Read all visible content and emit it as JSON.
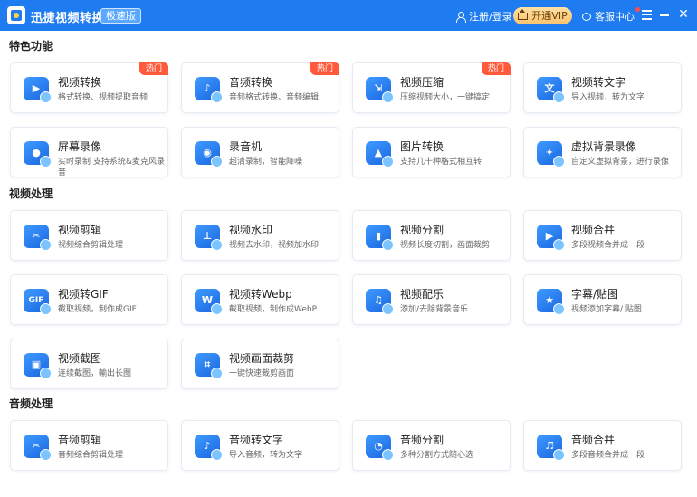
{
  "header": {
    "app_title": "迅捷视频转换器",
    "edition": "极速版",
    "login": "注册/登录",
    "vip": "开通VIP",
    "service": "客服中心",
    "close": "✕"
  },
  "colors": {
    "brand": "#1e7bf0",
    "hot_badge": "#ff5a3c",
    "vip_gold": "#f7c36e"
  },
  "sections": [
    {
      "title": "特色功能",
      "cards": [
        {
          "name": "视频转换",
          "desc": "格式转换、视频提取音频",
          "badge": "热门",
          "icon": "video-convert-icon",
          "glyph": "▶"
        },
        {
          "name": "音频转换",
          "desc": "音频格式转换、音频编辑",
          "badge": "热门",
          "icon": "audio-convert-icon",
          "glyph": "♪"
        },
        {
          "name": "视频压缩",
          "desc": "压缩视频大小，一键搞定",
          "badge": "热门",
          "icon": "video-compress-icon",
          "glyph": "⇲"
        },
        {
          "name": "视频转文字",
          "desc": "导入视频，转为文字",
          "badge": "",
          "icon": "video-to-text-icon",
          "glyph": "文"
        },
        {
          "name": "屏幕录像",
          "desc": "实时录制 支持系统&麦克风录音",
          "badge": "",
          "icon": "screen-record-icon",
          "glyph": "●"
        },
        {
          "name": "录音机",
          "desc": "超清录制，智能降噪",
          "badge": "",
          "icon": "recorder-icon",
          "glyph": "◉"
        },
        {
          "name": "图片转换",
          "desc": "支持几十种格式相互转",
          "badge": "",
          "icon": "image-convert-icon",
          "glyph": "▲"
        },
        {
          "name": "虚拟背景录像",
          "desc": "自定义虚拟背景，进行录像",
          "badge": "",
          "icon": "virtual-background-icon",
          "glyph": "✦"
        }
      ]
    },
    {
      "title": "视频处理",
      "cards": [
        {
          "name": "视频剪辑",
          "desc": "视频综合剪辑处理",
          "badge": "",
          "icon": "video-edit-icon",
          "glyph": "✂"
        },
        {
          "name": "视频水印",
          "desc": "视频去水印，视频加水印",
          "badge": "",
          "icon": "video-watermark-icon",
          "glyph": "⊥"
        },
        {
          "name": "视频分割",
          "desc": "视频长度切割，画面裁剪",
          "badge": "",
          "icon": "video-split-icon",
          "glyph": "▮"
        },
        {
          "name": "视频合并",
          "desc": "多段视频合并成一段",
          "badge": "",
          "icon": "video-merge-icon",
          "glyph": "▶"
        },
        {
          "name": "视频转GIF",
          "desc": "截取视频，制作成GIF",
          "badge": "",
          "icon": "video-to-gif-icon",
          "glyph": "GIF"
        },
        {
          "name": "视频转Webp",
          "desc": "截取视频，制作成WebP",
          "badge": "",
          "icon": "video-to-webp-icon",
          "glyph": "W"
        },
        {
          "name": "视频配乐",
          "desc": "添加/去除背景音乐",
          "badge": "",
          "icon": "video-music-icon",
          "glyph": "♫"
        },
        {
          "name": "字幕/贴图",
          "desc": "视频添加字幕/ 贴图",
          "badge": "",
          "icon": "subtitle-sticker-icon",
          "glyph": "★"
        },
        {
          "name": "视频截图",
          "desc": "连续截图，輸出长图",
          "badge": "",
          "icon": "video-screenshot-icon",
          "glyph": "▣"
        },
        {
          "name": "视频画面裁剪",
          "desc": "一键快速裁剪画面",
          "badge": "",
          "icon": "video-crop-icon",
          "glyph": "⌗"
        }
      ]
    },
    {
      "title": "音频处理",
      "cards": [
        {
          "name": "音频剪辑",
          "desc": "音频综合剪辑处理",
          "badge": "",
          "icon": "audio-edit-icon",
          "glyph": "✂"
        },
        {
          "name": "音频转文字",
          "desc": "导入音频，转为文字",
          "badge": "",
          "icon": "audio-to-text-icon",
          "glyph": "♪"
        },
        {
          "name": "音频分割",
          "desc": "多种分割方式随心选",
          "badge": "",
          "icon": "audio-split-icon",
          "glyph": "◔"
        },
        {
          "name": "音频合并",
          "desc": "多段音频合并成一段",
          "badge": "",
          "icon": "audio-merge-icon",
          "glyph": "♬"
        }
      ]
    }
  ]
}
